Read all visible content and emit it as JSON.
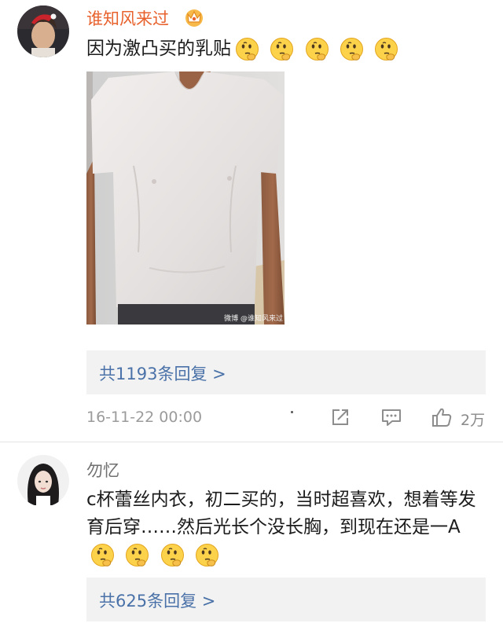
{
  "comments": [
    {
      "username": "谁知风来过",
      "badge_icon": "crown-badge-icon",
      "text": "因为激凸买的乳贴",
      "emoji_count": 5,
      "emoji_icon": "thinking-face-icon",
      "image": {
        "watermark": "微博 @谁知风来过",
        "subject": "white v-neck t-shirt"
      },
      "replies_label": "共1193条回复 >",
      "timestamp": "16-11-22 00:00",
      "like_count": "2万"
    },
    {
      "username": "勿忆",
      "text": "c杯蕾丝内衣，初二买的，当时超喜欢，想着等发育后穿……然后光长个没长胸，到现在还是一A",
      "emoji_count": 4,
      "emoji_icon": "thinking-face-icon",
      "replies_label": "共625条回复 >"
    }
  ],
  "colors": {
    "username_highlight": "#e8622d",
    "username_normal": "#707070",
    "link": "#4a72a8",
    "reply_background": "#f2f2f2",
    "meta_text": "#9b9b9b"
  }
}
